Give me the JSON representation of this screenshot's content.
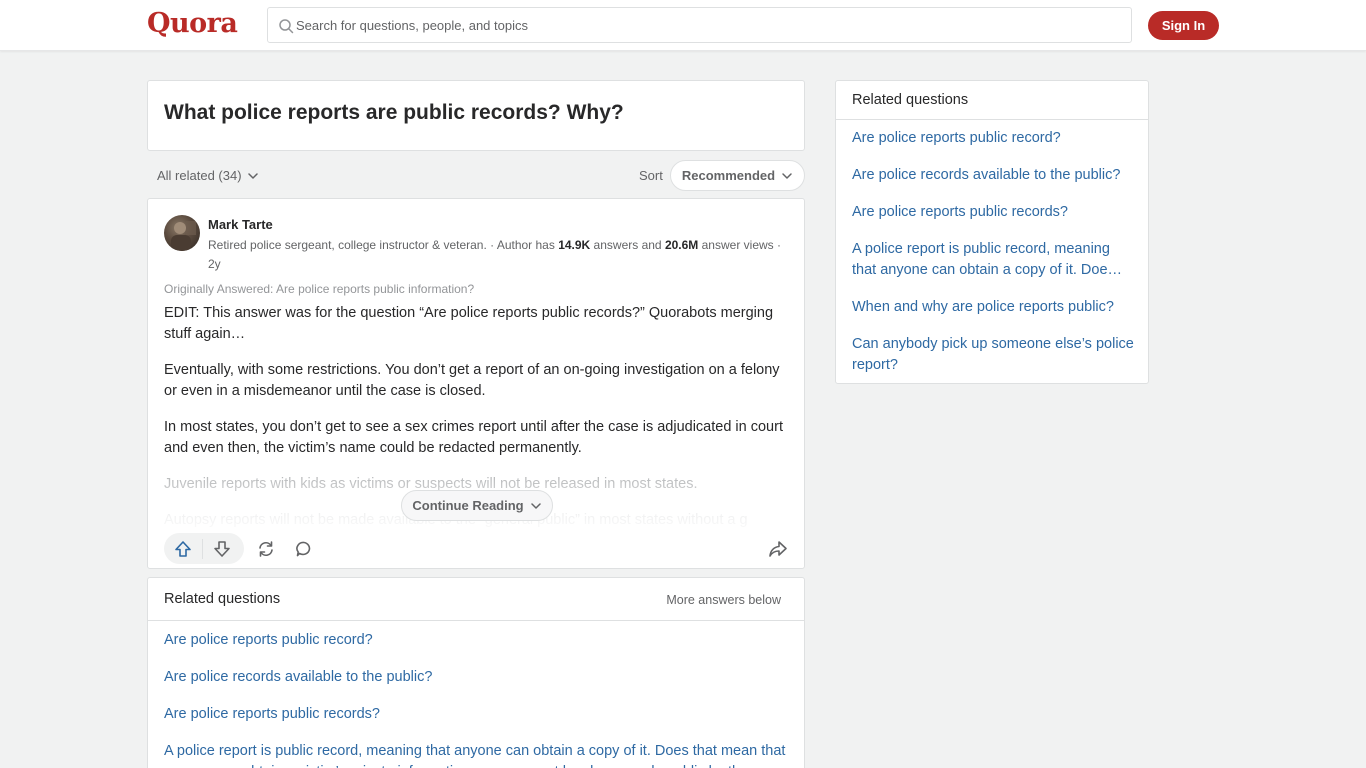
{
  "header": {
    "logo": "Quora",
    "search_placeholder": "Search for questions, people, and topics",
    "signin_label": "Sign In"
  },
  "question": {
    "title": "What police reports are public records? Why?"
  },
  "filters": {
    "all_related": "All related (34)",
    "sort_label": "Sort",
    "sort_value": "Recommended"
  },
  "answer": {
    "author_name": "Mark Tarte",
    "credential_prefix": "Retired police sergeant, college instructor & veteran. · Author has ",
    "answers_count": "14.9K",
    "credential_mid": " answers and ",
    "views_count": "20.6M",
    "credential_suffix": " answer views · 2y",
    "originally_answered": "Originally Answered: Are police reports public information?",
    "paragraphs": [
      "EDIT: This answer was for the question “Are police reports public records?” Quorabots merging stuff again…",
      "Eventually, with some restrictions. You don’t get a report of an on-going investigation on a felony or even in a misdemeanor until the case is closed.",
      "In most states, you don’t get to see a sex crimes report until after the case is adjudicated in court and even then, the victim’s name could be redacted permanently.",
      "Juvenile reports with kids as victims or suspects will not be released in most states.",
      "Autopsy reports will not be made available to the “general public” in most states without a g"
    ],
    "continue_label": "Continue Reading"
  },
  "related_inline": {
    "title": "Related questions",
    "more_label": "More answers below",
    "items": [
      "Are police reports public record?",
      "Are police records available to the public?",
      "Are police reports public records?",
      "A police report is public record, meaning that anyone can obtain a copy of it. Does that mean that anyone can obtain a victim’s private information once a report has been made public by the"
    ]
  },
  "sidebar": {
    "title": "Related questions",
    "items": [
      "Are police reports public record?",
      "Are police records available to the public?",
      "Are police reports public records?",
      "A police report is public record, meaning that anyone can obtain a copy of it. Doe…",
      "When and why are police reports public?",
      "Can anybody pick up someone else’s police report?"
    ]
  },
  "colors": {
    "brand": "#b92b27",
    "link": "#2e69a3",
    "upvote": "#2e69a3"
  }
}
